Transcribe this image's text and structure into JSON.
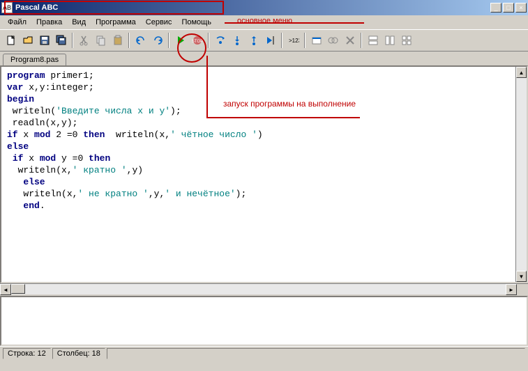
{
  "window": {
    "title": "Pascal ABC",
    "icon_text": "AB"
  },
  "menu": {
    "items": [
      "Файл",
      "Правка",
      "Вид",
      "Программа",
      "Сервис",
      "Помощь"
    ]
  },
  "annotations": {
    "main_menu": "основное меню",
    "run": "запуск программы на выполнение"
  },
  "toolbar": {
    "icons": [
      "new",
      "open",
      "save",
      "save-all",
      "cut",
      "copy",
      "paste",
      "undo",
      "redo",
      "run",
      "stop",
      "step-over",
      "step-into",
      "step-out",
      "run-to",
      "var-watch",
      "windows",
      "cascade",
      "close-all",
      "tile-h",
      "tile-v",
      "tile"
    ]
  },
  "tab": {
    "name": "Program8.pas"
  },
  "code": {
    "lines": [
      {
        "t": "program",
        "k": true
      },
      {
        "t": " primer1;"
      },
      {
        "br": 1
      },
      {
        "t": "var",
        "k": true
      },
      {
        "t": " x,y:integer;"
      },
      {
        "br": 1
      },
      {
        "t": "begin",
        "k": true
      },
      {
        "br": 1
      },
      {
        "t": " writeln("
      },
      {
        "t": "'Введите числа x и y'",
        "s": true
      },
      {
        "t": ");"
      },
      {
        "br": 1
      },
      {
        "t": " readln(x,y);"
      },
      {
        "br": 1
      },
      {
        "t": "if",
        "k": true
      },
      {
        "t": " x "
      },
      {
        "t": "mod",
        "k": true
      },
      {
        "t": " 2 =0 "
      },
      {
        "t": "then",
        "k": true
      },
      {
        "t": "  writeln(x,"
      },
      {
        "t": "' чётное число '",
        "s": true
      },
      {
        "t": ")"
      },
      {
        "br": 1
      },
      {
        "t": "else",
        "k": true
      },
      {
        "br": 1
      },
      {
        "t": " "
      },
      {
        "t": "if",
        "k": true
      },
      {
        "t": " x "
      },
      {
        "t": "mod",
        "k": true
      },
      {
        "t": " y =0 "
      },
      {
        "t": "then",
        "k": true
      },
      {
        "br": 1
      },
      {
        "t": "  writeln(x,"
      },
      {
        "t": "' кратно '",
        "s": true
      },
      {
        "t": ",y)"
      },
      {
        "br": 1
      },
      {
        "t": "   "
      },
      {
        "t": "else",
        "k": true
      },
      {
        "br": 1
      },
      {
        "t": "   writeln(x,"
      },
      {
        "t": "' не кратно '",
        "s": true
      },
      {
        "t": ",y,"
      },
      {
        "t": "' и нечётное'",
        "s": true
      },
      {
        "t": ");"
      },
      {
        "br": 1
      },
      {
        "t": "   "
      },
      {
        "t": "end",
        "k": true
      },
      {
        "t": "."
      }
    ]
  },
  "status": {
    "line_label": "Строка:",
    "line": "12",
    "col_label": "Столбец:",
    "col": "18"
  }
}
